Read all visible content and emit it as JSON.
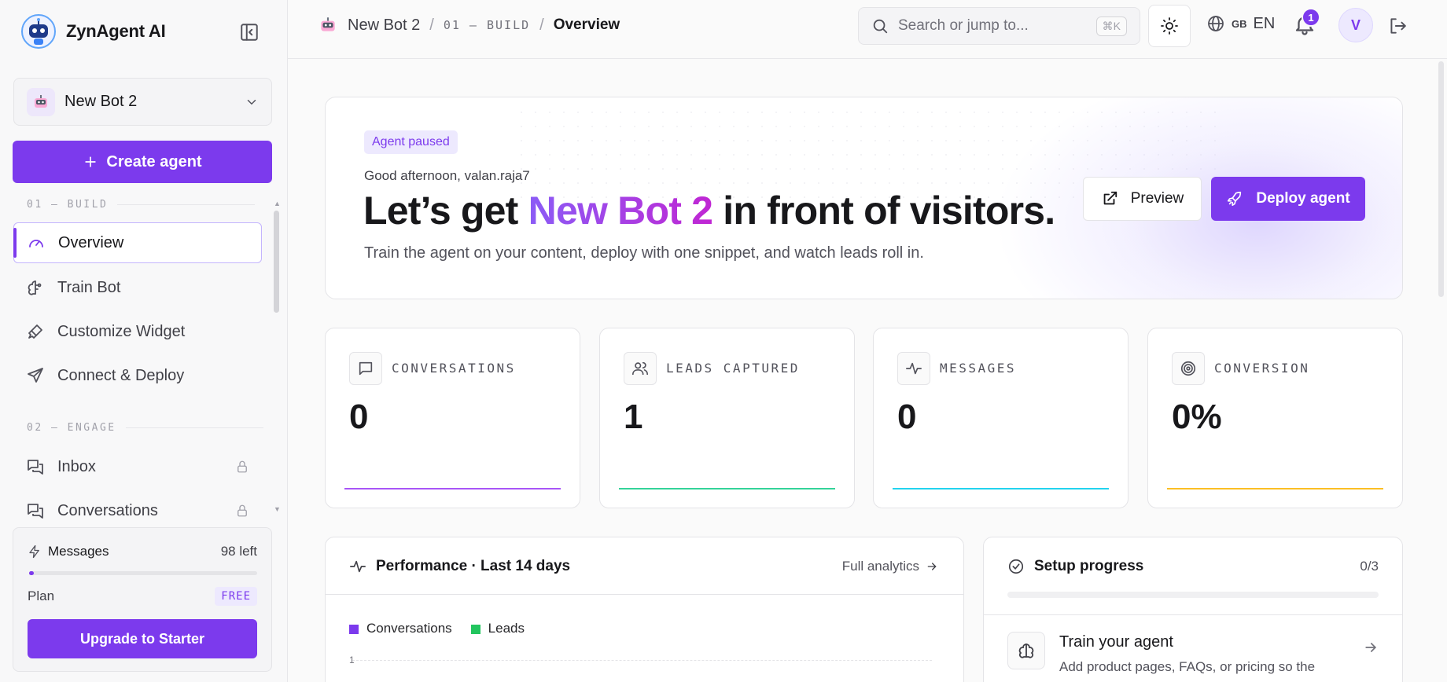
{
  "brand": {
    "name": "ZynAgent AI"
  },
  "bot_selector": {
    "name": "New Bot 2"
  },
  "sidebar": {
    "create_label": "Create agent",
    "section_build": "01 — BUILD",
    "section_engage": "02 — ENGAGE",
    "items": [
      {
        "label": "Overview",
        "icon": "gauge-icon",
        "active": true
      },
      {
        "label": "Train Bot",
        "icon": "brain-icon"
      },
      {
        "label": "Customize Widget",
        "icon": "brush-icon"
      },
      {
        "label": "Connect & Deploy",
        "icon": "send-icon"
      },
      {
        "label": "Inbox",
        "icon": "chat-icon",
        "locked": true
      },
      {
        "label": "Conversations",
        "icon": "chat-icon",
        "locked": true
      }
    ]
  },
  "usage": {
    "messages_label": "Messages",
    "messages_left": "98 left",
    "messages_used_fraction": 0.02,
    "plan_label": "Plan",
    "plan_badge": "FREE",
    "upgrade_label": "Upgrade to Starter"
  },
  "topbar": {
    "crumb_bot": "New Bot 2",
    "crumb_section": "01 — BUILD",
    "crumb_current": "Overview",
    "search_placeholder": "Search or jump to...",
    "search_shortcut": "⌘K",
    "lang_flag": "GB",
    "lang_code": "EN",
    "notifications_count": "1",
    "avatar_initial": "V"
  },
  "hero": {
    "status": "Agent paused",
    "greeting": "Good afternoon, valan.raja7",
    "title_before": "Let’s get ",
    "title_accent": "New Bot 2",
    "title_after": " in front of visitors.",
    "subtitle": "Train the agent on your content, deploy with one snippet, and watch leads roll in.",
    "preview_label": "Preview",
    "deploy_label": "Deploy agent"
  },
  "stats": [
    {
      "label": "CONVERSATIONS",
      "value": "0",
      "icon": "message-square-icon",
      "color": "#a855f7"
    },
    {
      "label": "LEADS CAPTURED",
      "value": "1",
      "icon": "users-icon",
      "color": "#34d399"
    },
    {
      "label": "MESSAGES",
      "value": "0",
      "icon": "activity-icon",
      "color": "#22d3ee"
    },
    {
      "label": "CONVERSION",
      "value": "0%",
      "icon": "target-icon",
      "color": "#fbbf24"
    }
  ],
  "performance": {
    "title": "Performance · Last 14 days",
    "link": "Full analytics",
    "legend": [
      {
        "name": "Conversations",
        "color": "#7c3aed"
      },
      {
        "name": "Leads",
        "color": "#22c55e"
      }
    ],
    "first_tick": "1"
  },
  "setup": {
    "title": "Setup progress",
    "count": "0/3",
    "progress_fraction": 0,
    "step_title": "Train your agent",
    "step_desc": "Add product pages, FAQs, or pricing so the"
  }
}
